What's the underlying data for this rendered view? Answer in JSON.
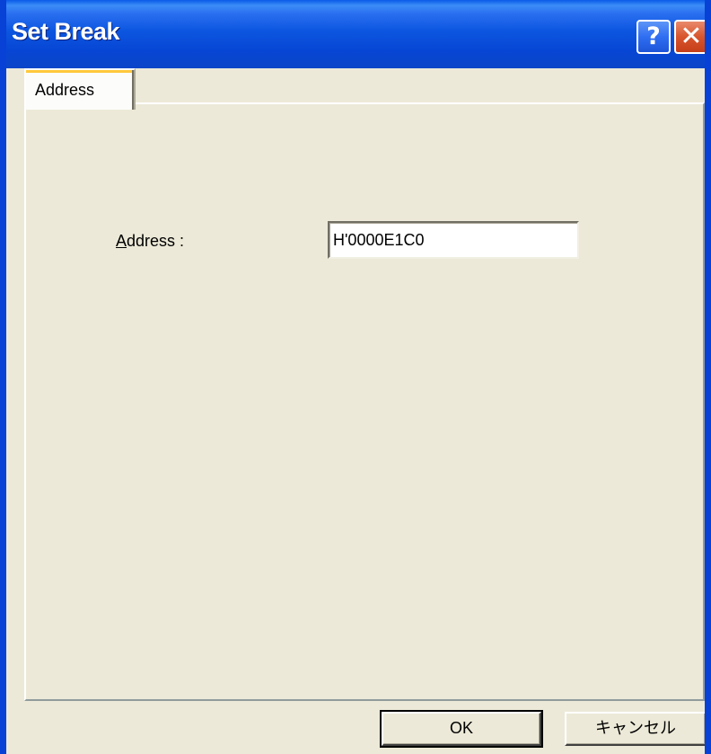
{
  "window": {
    "title": "Set Break",
    "help_glyph": "?",
    "close_glyph": "✕"
  },
  "tabs": [
    {
      "label": "Address",
      "selected": true
    }
  ],
  "form": {
    "address_label_accel": "A",
    "address_label_rest": "ddress :",
    "address_value": "H'0000E1C0"
  },
  "buttons": {
    "ok_label": "OK",
    "cancel_label": "キャンセル"
  },
  "colors": {
    "titlebar": "#0846d6",
    "dialog_face": "#ece9d8",
    "close_button": "#d8552d"
  }
}
